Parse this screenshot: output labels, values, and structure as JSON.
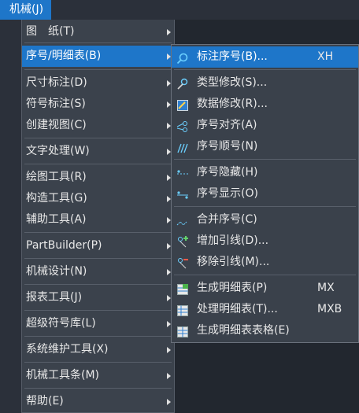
{
  "menubar": {
    "label": "机械(J)"
  },
  "main_menu": [
    {
      "label": "图　纸(T)",
      "submenu": true
    },
    {
      "label": "序号/明细表(B)",
      "submenu": true,
      "active": true
    },
    {
      "label": "尺寸标注(D)",
      "submenu": true
    },
    {
      "label": "符号标注(S)",
      "submenu": true
    },
    {
      "label": "创建视图(C)",
      "submenu": true
    },
    {
      "label": "文字处理(W)",
      "submenu": true
    },
    {
      "label": "绘图工具(R)",
      "submenu": true
    },
    {
      "label": "构造工具(G)",
      "submenu": true
    },
    {
      "label": "辅助工具(A)",
      "submenu": true
    },
    {
      "label": "PartBuilder(P)",
      "submenu": true
    },
    {
      "label": "机械设计(N)",
      "submenu": true
    },
    {
      "label": "报表工具(J)",
      "submenu": true
    },
    {
      "label": "超级符号库(L)",
      "submenu": true
    },
    {
      "label": "系统维护工具(X)",
      "submenu": true
    },
    {
      "label": "机械工具条(M)",
      "submenu": true
    },
    {
      "label": "帮助(E)",
      "submenu": true
    }
  ],
  "sub_menu": [
    {
      "label": "标注序号(B)...",
      "shortcut": "XH",
      "icon": "magnifier-balloon-icon",
      "active": true
    },
    {
      "label": "类型修改(S)...",
      "shortcut": "",
      "icon": "balloon-type-edit-icon"
    },
    {
      "label": "数据修改(R)...",
      "shortcut": "",
      "icon": "data-edit-icon"
    },
    {
      "label": "序号对齐(A)",
      "shortcut": "",
      "icon": "balloon-align-icon"
    },
    {
      "label": "序号顺号(N)",
      "shortcut": "",
      "icon": "balloon-renumber-icon"
    },
    {
      "label": "序号隐藏(H)",
      "shortcut": "",
      "icon": "balloon-hide-icon"
    },
    {
      "label": "序号显示(O)",
      "shortcut": "",
      "icon": "balloon-show-icon"
    },
    {
      "label": "合并序号(C)",
      "shortcut": "",
      "icon": "balloon-merge-icon"
    },
    {
      "label": "增加引线(D)...",
      "shortcut": "",
      "icon": "add-leader-icon"
    },
    {
      "label": "移除引线(M)...",
      "shortcut": "",
      "icon": "remove-leader-icon"
    },
    {
      "label": "生成明细表(P)",
      "shortcut": "MX",
      "icon": "create-bom-icon"
    },
    {
      "label": "处理明细表(T)...",
      "shortcut": "MXB",
      "icon": "process-bom-icon"
    },
    {
      "label": "生成明细表表格(E)",
      "shortcut": "",
      "icon": "bom-table-icon"
    }
  ],
  "colors": {
    "accent": "#1e76c9",
    "menu_bg": "#3b424c",
    "canvas": "#22272f"
  }
}
